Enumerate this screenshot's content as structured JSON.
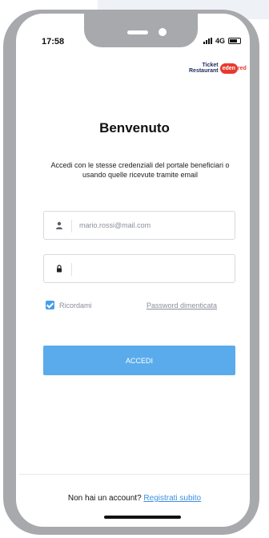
{
  "status_bar": {
    "time": "17:58",
    "network": "4G"
  },
  "brand": {
    "line1": "Ticket",
    "line2": "Restaurant",
    "badge": "eden",
    "suffix": "red"
  },
  "login": {
    "title": "Benvenuto",
    "subtitle": "Accedi con le stesse credenziali del portale beneficiari o usando quelle ricevute tramite email",
    "email_placeholder": "mario.rossi@mail.com",
    "password_placeholder": "",
    "remember_label": "Ricordami",
    "remember_checked": true,
    "forgot_label": "Password dimenticata",
    "submit_label": "ACCEDI"
  },
  "footer": {
    "prompt": "Non hai un account?",
    "register_label": "Registrati subito"
  },
  "colors": {
    "accent": "#5aabeb",
    "link": "#3d8fdf",
    "brand_red": "#e8392f",
    "frame": "#a7a9ac"
  }
}
